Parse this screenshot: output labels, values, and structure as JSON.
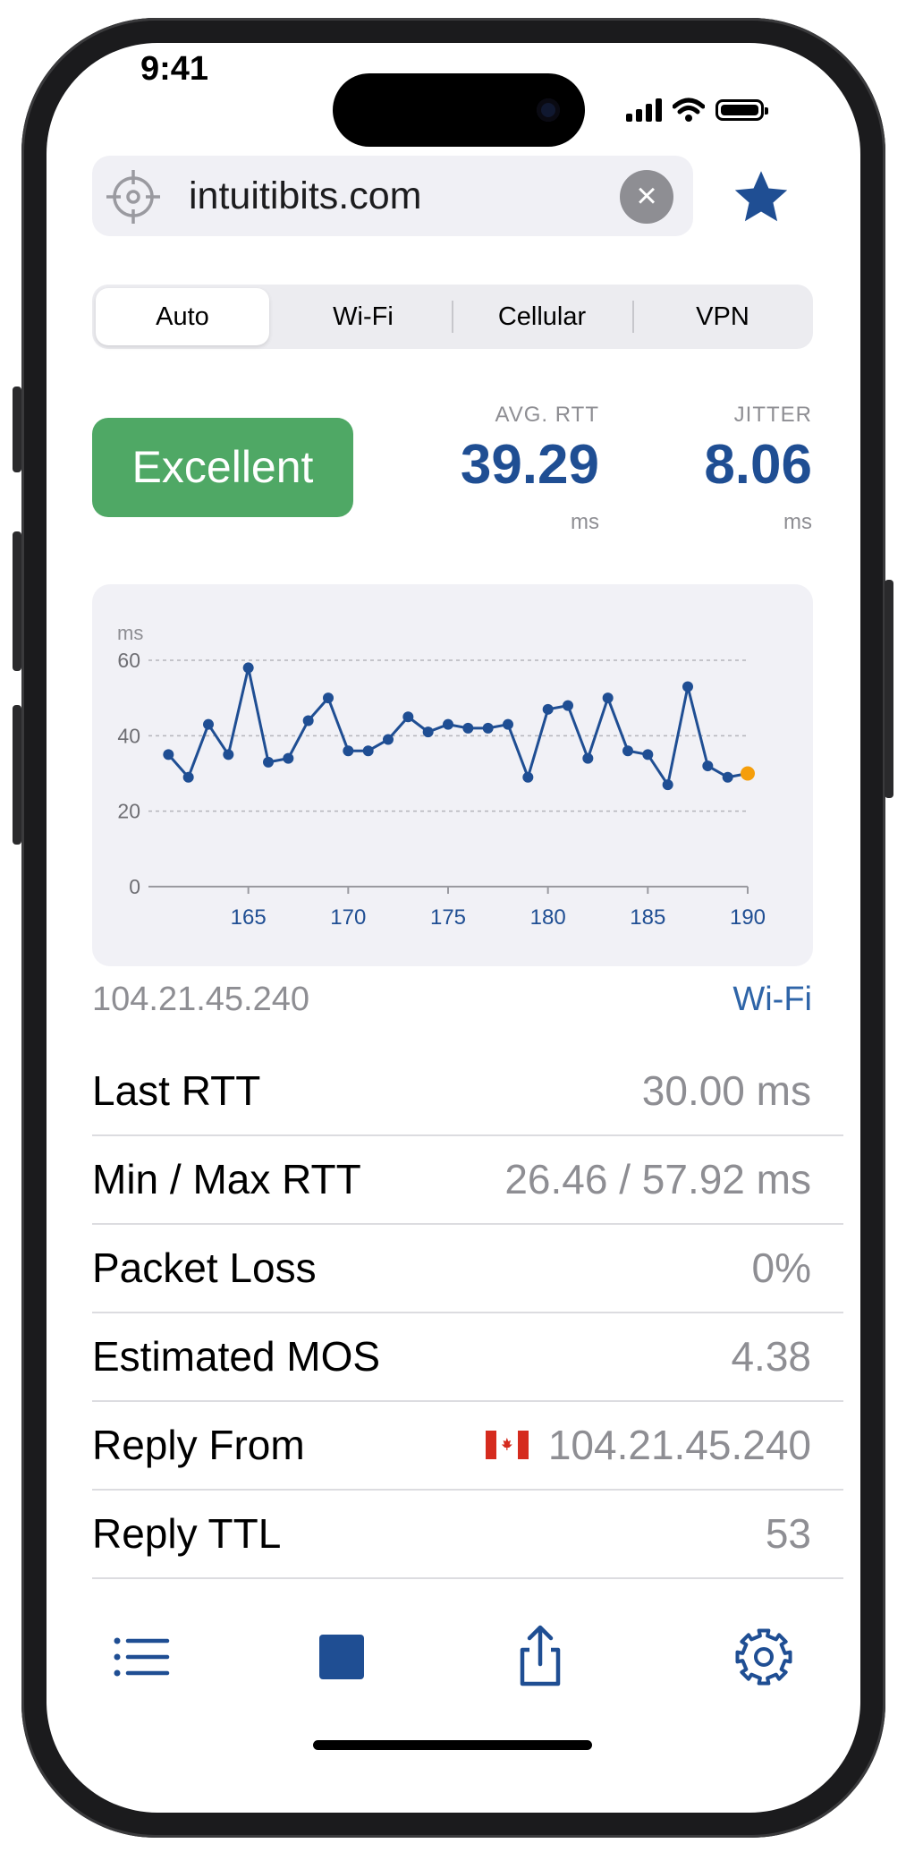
{
  "status_bar": {
    "time": "9:41"
  },
  "url_bar": {
    "text": "intuitibits.com"
  },
  "segments": [
    {
      "label": "Auto",
      "active": true
    },
    {
      "label": "Wi-Fi",
      "active": false
    },
    {
      "label": "Cellular",
      "active": false
    },
    {
      "label": "VPN",
      "active": false
    }
  ],
  "quality": {
    "label": "Excellent",
    "color": "#4fa865"
  },
  "metrics": {
    "avg_rtt": {
      "label": "AVG. RTT",
      "value": "39.29",
      "unit": "ms"
    },
    "jitter": {
      "label": "JITTER",
      "value": "8.06",
      "unit": "ms"
    }
  },
  "chart_data": {
    "type": "line",
    "ylabel": "ms",
    "ylim": [
      0,
      60
    ],
    "xlim": [
      160,
      190
    ],
    "y_ticks": [
      0,
      20,
      40,
      60
    ],
    "x_ticks": [
      165,
      170,
      175,
      180,
      185,
      190
    ],
    "grid": true,
    "series": [
      {
        "x": [
          161,
          162,
          163,
          164,
          165,
          166,
          167,
          168,
          169,
          170,
          171,
          172,
          173,
          174,
          175,
          176,
          177,
          178,
          179,
          180,
          181,
          182,
          183,
          184,
          185,
          186,
          187,
          188,
          189,
          190
        ],
        "values": [
          35,
          29,
          43,
          35,
          58,
          33,
          34,
          44,
          50,
          36,
          36,
          39,
          45,
          41,
          43,
          42,
          42,
          43,
          29,
          47,
          48,
          34,
          50,
          36,
          35,
          27,
          53,
          32,
          29,
          30
        ],
        "color": "#1f4e93",
        "last_point_color": "#f59e0b"
      }
    ]
  },
  "address": {
    "ip": "104.21.45.240",
    "network": "Wi-Fi"
  },
  "stats": [
    {
      "label": "Last RTT",
      "value": "30.00 ms"
    },
    {
      "label": "Min / Max RTT",
      "value": "26.46 / 57.92 ms"
    },
    {
      "label": "Packet Loss",
      "value": "0%"
    },
    {
      "label": "Estimated MOS",
      "value": "4.38"
    },
    {
      "label": "Reply From",
      "value": "104.21.45.240",
      "flag": "canada-flag-icon"
    },
    {
      "label": "Reply TTL",
      "value": "53"
    }
  ],
  "toolbar": {
    "icons": [
      "list-icon",
      "stop-icon",
      "share-icon",
      "gear-icon"
    ],
    "accent": "#1f4e93"
  }
}
